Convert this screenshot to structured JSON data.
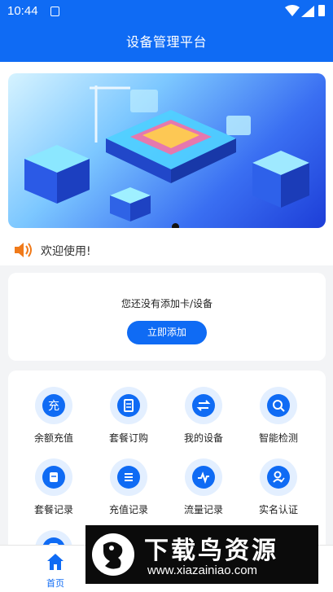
{
  "status_bar": {
    "time": "10:44"
  },
  "header": {
    "title": "设备管理平台"
  },
  "banner": {
    "active_slide": 1
  },
  "notice": {
    "text": "欢迎使用!"
  },
  "empty_device": {
    "message": "您还没有添加卡/设备",
    "add_button": "立即添加"
  },
  "features": [
    {
      "label": "余额充值",
      "icon": "recharge-icon"
    },
    {
      "label": "套餐订购",
      "icon": "package-order-icon"
    },
    {
      "label": "我的设备",
      "icon": "device-switch-icon"
    },
    {
      "label": "智能检测",
      "icon": "search-icon"
    },
    {
      "label": "套餐记录",
      "icon": "package-record-icon"
    },
    {
      "label": "充值记录",
      "icon": "list-icon"
    },
    {
      "label": "流量记录",
      "icon": "traffic-icon"
    },
    {
      "label": "实名认证",
      "icon": "verify-icon"
    }
  ],
  "bottom_nav": [
    {
      "label": "首页",
      "icon": "home-icon",
      "active": true
    }
  ],
  "watermark": {
    "big": "下载鸟资源",
    "small": "www.xiazainiao.com"
  },
  "colors": {
    "primary": "#0f6bf4",
    "icon_bg": "#e3efff",
    "speaker": "#f07a1a"
  }
}
